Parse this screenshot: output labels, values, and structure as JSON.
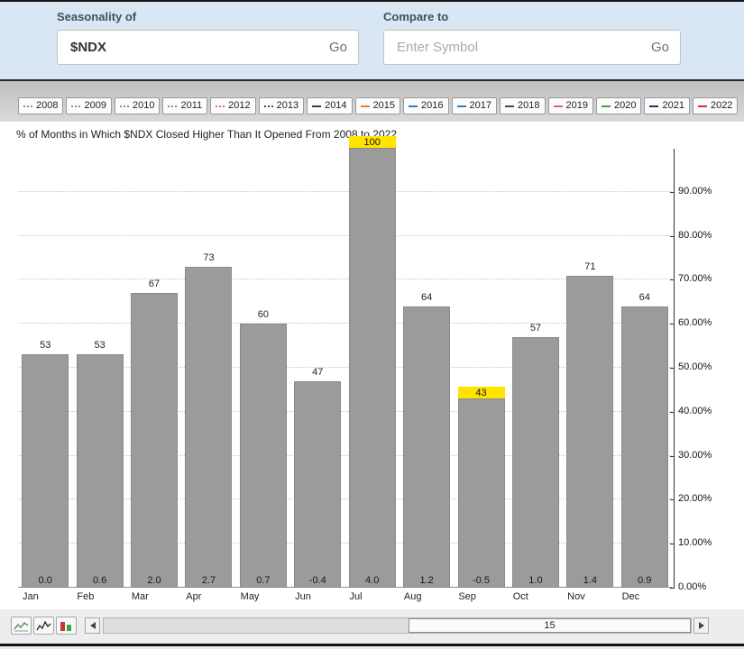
{
  "header": {
    "seasonality_label": "Seasonality of",
    "symbol_value": "$NDX",
    "symbol_go_label": "Go",
    "compare_label": "Compare to",
    "compare_placeholder": "Enter Symbol",
    "compare_go_label": "Go"
  },
  "legend": {
    "years": [
      {
        "label": "2008",
        "style": "dotted",
        "color": "#8f8f8f"
      },
      {
        "label": "2009",
        "style": "dotted",
        "color": "#8f8f8f"
      },
      {
        "label": "2010",
        "style": "dotted",
        "color": "#8f8f8f"
      },
      {
        "label": "2011",
        "style": "dotted",
        "color": "#8f8f8f"
      },
      {
        "label": "2012",
        "style": "dotted",
        "color": "#e05fa0"
      },
      {
        "label": "2013",
        "style": "dotted",
        "color": "#4a4a4a"
      },
      {
        "label": "2014",
        "style": "solid",
        "color": "#3a3a3a"
      },
      {
        "label": "2015",
        "style": "solid",
        "color": "#ef7d22"
      },
      {
        "label": "2016",
        "style": "solid",
        "color": "#2f7fbf"
      },
      {
        "label": "2017",
        "style": "solid",
        "color": "#2f7fbf"
      },
      {
        "label": "2018",
        "style": "solid",
        "color": "#4a4a4a"
      },
      {
        "label": "2019",
        "style": "solid",
        "color": "#d855b0"
      },
      {
        "label": "2020",
        "style": "solid",
        "color": "#3ba43b"
      },
      {
        "label": "2021",
        "style": "solid",
        "color": "#23355f"
      },
      {
        "label": "2022",
        "style": "solid",
        "color": "#cf3030"
      }
    ]
  },
  "chart_data": {
    "type": "bar",
    "title": "% of Months in Which $NDX Closed Higher Than It Opened From 2008 to 2022",
    "categories": [
      "Jan",
      "Feb",
      "Mar",
      "Apr",
      "May",
      "Jun",
      "Jul",
      "Aug",
      "Sep",
      "Oct",
      "Nov",
      "Dec"
    ],
    "values": [
      53,
      53,
      67,
      73,
      60,
      47,
      100,
      64,
      43,
      57,
      71,
      64
    ],
    "bottom_values": [
      "0.0",
      "0.6",
      "2.0",
      "2.7",
      "0.7",
      "-0.4",
      "4.0",
      "1.2",
      "-0.5",
      "1.0",
      "1.4",
      "0.9"
    ],
    "y_ticks": [
      "90.00%",
      "80.00%",
      "70.00%",
      "60.00%",
      "50.00%",
      "40.00%",
      "30.00%",
      "20.00%",
      "10.00%",
      "0.00%"
    ],
    "ylim": [
      0,
      100
    ],
    "xlabel": "",
    "ylabel": "",
    "grid": true,
    "legend_position": "top",
    "bar_color": "#9b9b9b",
    "highlight_color": "#ffe400",
    "highlight_indices": [
      6,
      8
    ]
  },
  "toolbar": {
    "scrollbar_value": "15",
    "icons": [
      "line-chart-icon",
      "zigzag-line-icon",
      "volume-bars-icon"
    ]
  }
}
